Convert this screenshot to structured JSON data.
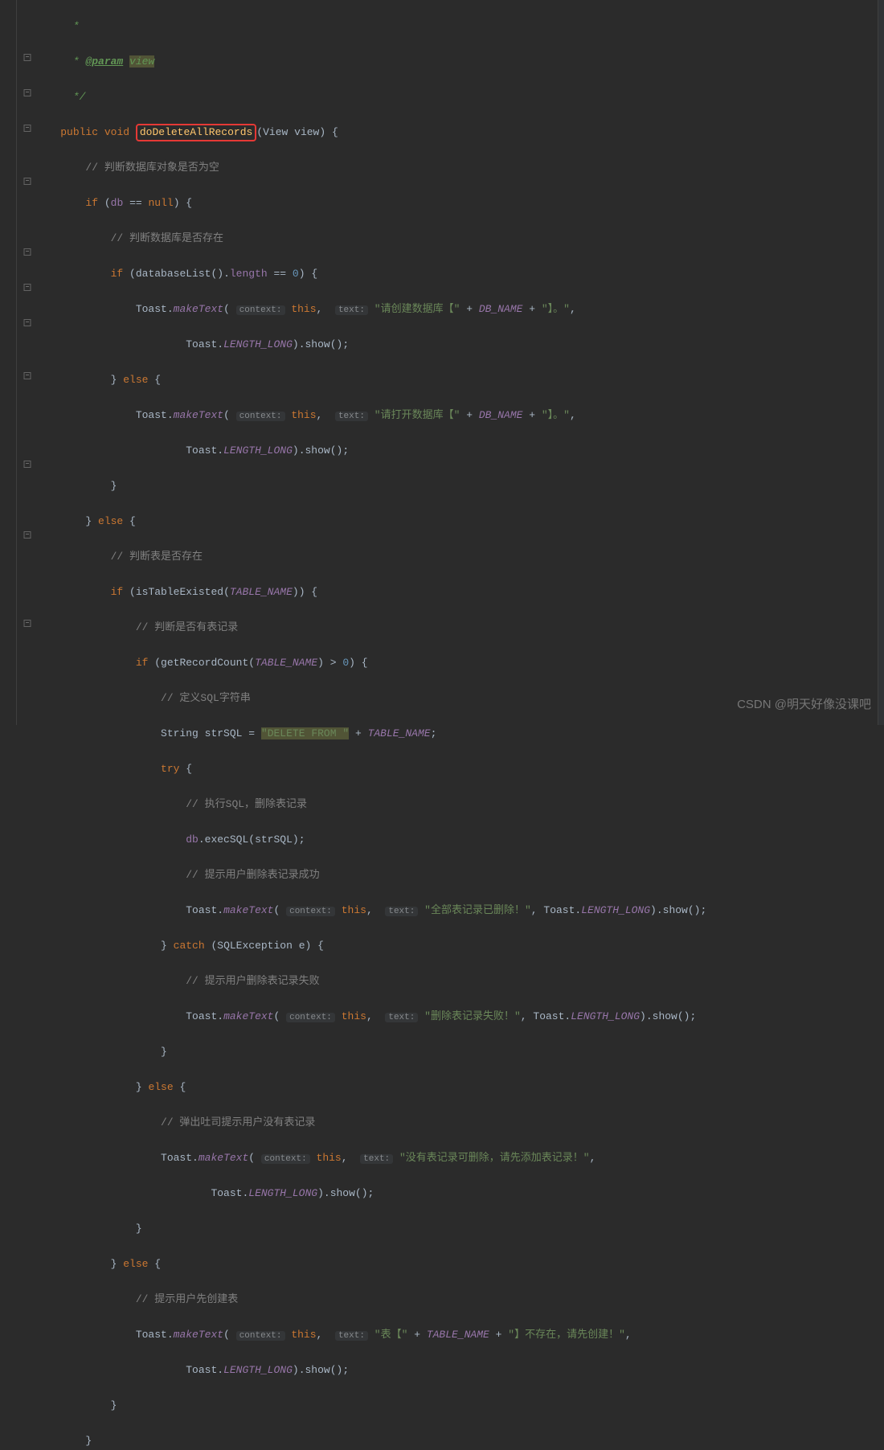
{
  "colors": {
    "keyword": "#cc7832",
    "method": "#ffc66d",
    "string": "#6a8759",
    "number": "#6897bb",
    "comment": "#808080",
    "field": "#9876aa",
    "highlight_box": "#e53935"
  },
  "doc": {
    "star": " *",
    "param_tag": "@param",
    "param_name": "view",
    "close": " */"
  },
  "hints": {
    "context": "context:",
    "text": "text:"
  },
  "sig": {
    "public": "public",
    "void": "void",
    "method_name": "doDeleteAllRecords",
    "param_type": "View",
    "param_name": "view"
  },
  "c": {
    "db_null": "// 判断数据库对象是否为空",
    "db_exist": "// 判断数据库是否存在",
    "table_exist": "// 判断表是否存在",
    "has_records": "// 判断是否有表记录",
    "define_sql": "// 定义SQL字符串",
    "exec_sql": "// 执行SQL，删除表记录",
    "del_ok": "// 提示用户删除表记录成功",
    "del_fail": "// 提示用户删除表记录失败",
    "no_records": "// 弹出吐司提示用户没有表记录",
    "create_table_first": "// 提示用户先创建表"
  },
  "kw": {
    "if": "if",
    "else": "else",
    "null": "null",
    "try": "try",
    "catch": "catch",
    "this": "this",
    "string_type": "String"
  },
  "ids": {
    "db": "db",
    "databaseList": "databaseList",
    "length": "length",
    "Toast": "Toast",
    "makeText": "makeText",
    "DB_NAME": "DB_NAME",
    "TABLE_NAME": "TABLE_NAME",
    "LENGTH_LONG": "LENGTH_LONG",
    "show": "show",
    "isTableExisted": "isTableExisted",
    "getRecordCount": "getRecordCount",
    "strSQL": "strSQL",
    "execSQL": "execSQL",
    "SQLException": "SQLException",
    "e": "e"
  },
  "lit": {
    "zero": "0",
    "eqeq": "==",
    "gt": ">",
    "eq": "=",
    "plus": "+"
  },
  "strs": {
    "please_create_db_l": "\"请创建数据库【\"",
    "please_open_db_l": "\"请打开数据库【\"",
    "db_r": "\"】。\"",
    "delete_from": "\"DELETE FROM \"",
    "all_deleted": "\"全部表记录已删除！\"",
    "delete_fail": "\"删除表记录失败！\"",
    "no_records": "\"没有表记录可删除，请先添加表记录！\"",
    "table_l": "\"表【\"",
    "table_r": "\"】不存在，请先创建！\""
  },
  "watermark": "CSDN @明天好像没课吧"
}
